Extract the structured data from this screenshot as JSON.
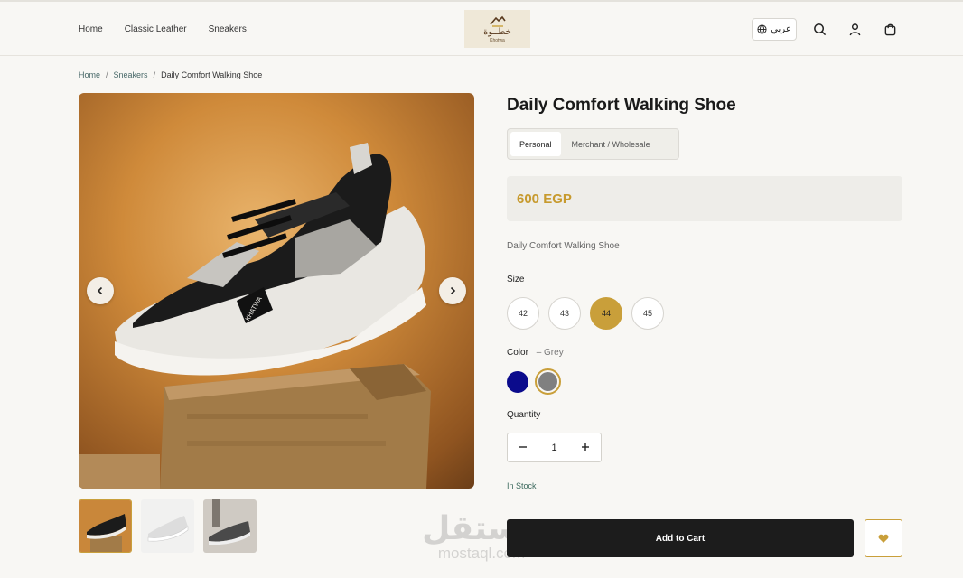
{
  "nav": {
    "items": [
      "Home",
      "Classic Leather",
      "Sneakers"
    ]
  },
  "logo": {
    "arabic": "خطــوة",
    "latin": "Khotwa"
  },
  "header": {
    "lang_label": "عربي",
    "icons": [
      "globe-icon",
      "search-icon",
      "user-icon",
      "cart-icon"
    ]
  },
  "breadcrumb": {
    "home": "Home",
    "sep": "/",
    "category": "Sneakers",
    "current": "Daily Comfort Walking Shoe"
  },
  "product": {
    "title": "Daily Comfort Walking Shoe",
    "tabs": [
      "Personal",
      "Merchant / Wholesale"
    ],
    "active_tab": "Personal",
    "price": "600 EGP",
    "description": "Daily Comfort Walking Shoe",
    "size_label": "Size",
    "sizes": [
      "42",
      "43",
      "44",
      "45"
    ],
    "selected_size": "44",
    "color_label": "Color",
    "color_selected": "– Grey",
    "colors": [
      {
        "name": "Navy",
        "hex": "#0b0b8c"
      },
      {
        "name": "Grey",
        "hex": "#808080"
      }
    ],
    "quantity_label": "Quantity",
    "quantity": "1",
    "stock": "In Stock",
    "add_to_cart": "Add to Cart"
  },
  "gallery": {
    "prev_icon": "chevron-left-icon",
    "next_icon": "chevron-right-icon",
    "thumb_count": 3
  },
  "watermark": {
    "arabic": "مستقل",
    "latin": "mostaql.com"
  },
  "colors": {
    "accent": "#c99f3a",
    "dark": "#1c1c1c",
    "bg": "#f8f7f4"
  }
}
